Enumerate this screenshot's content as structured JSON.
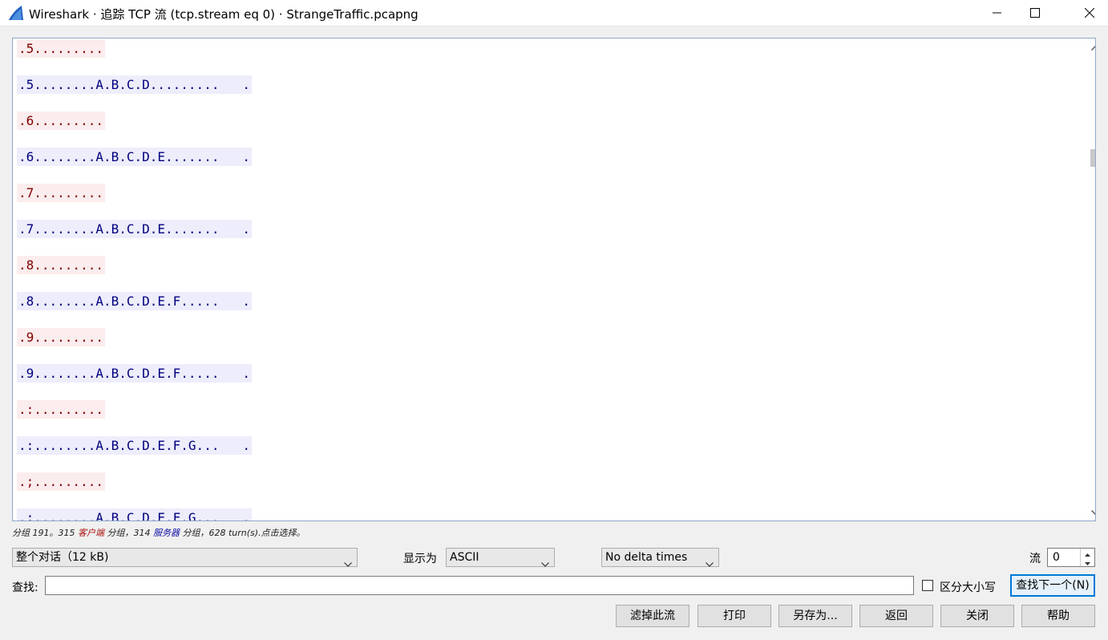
{
  "window": {
    "title": "Wireshark · 追踪 TCP 流 (tcp.stream eq 0) · StrangeTraffic.pcapng",
    "app_icon": "wireshark-fin-icon",
    "controls": [
      "minimize-icon",
      "maximize-icon",
      "close-icon"
    ]
  },
  "colors": {
    "client_text": "#7f0000",
    "client_bg": "#fbeded",
    "server_text": "#00007f",
    "server_bg": "#ededfb",
    "default_button_border": "#0078d7"
  },
  "stream": {
    "lines": [
      {
        "side": "client",
        "text": ".5........."
      },
      {
        "side": "server",
        "text": ".5........A.B.C.D.........   ."
      },
      {
        "side": "client",
        "text": ".6........."
      },
      {
        "side": "server",
        "text": ".6........A.B.C.D.E.......   ."
      },
      {
        "side": "client",
        "text": ".7........."
      },
      {
        "side": "server",
        "text": ".7........A.B.C.D.E.......   ."
      },
      {
        "side": "client",
        "text": ".8........."
      },
      {
        "side": "server",
        "text": ".8........A.B.C.D.E.F.....   ."
      },
      {
        "side": "client",
        "text": ".9........."
      },
      {
        "side": "server",
        "text": ".9........A.B.C.D.E.F.....   ."
      },
      {
        "side": "client",
        "text": ".:........."
      },
      {
        "side": "server",
        "text": ".:........A.B.C.D.E.F.G...   ."
      },
      {
        "side": "client",
        "text": ".;........."
      },
      {
        "side": "server",
        "text": ".;........A.B.C.D.E.F.G...   ."
      }
    ]
  },
  "status": {
    "prefix": "分组 191。315 ",
    "client_word": "客户端",
    "middle": " 分组，314 ",
    "server_word": "服务器",
    "suffix": " 分组，628 turn(s).点击选择。"
  },
  "controls": {
    "conversation_select": "整个对话（12 kB)",
    "show_as_label": "显示为",
    "show_as_select": "ASCII",
    "delta_select": "No delta times",
    "stream_label": "流",
    "stream_value": "0",
    "find_label": "查找:",
    "find_value": "",
    "case_sensitive_label": "区分大小写",
    "find_next_button": "查找下一个(N)"
  },
  "buttons": {
    "filter_out": "滤掉此流",
    "print": "打印",
    "save_as": "另存为...",
    "back": "返回",
    "close": "关闭",
    "help": "帮助"
  }
}
